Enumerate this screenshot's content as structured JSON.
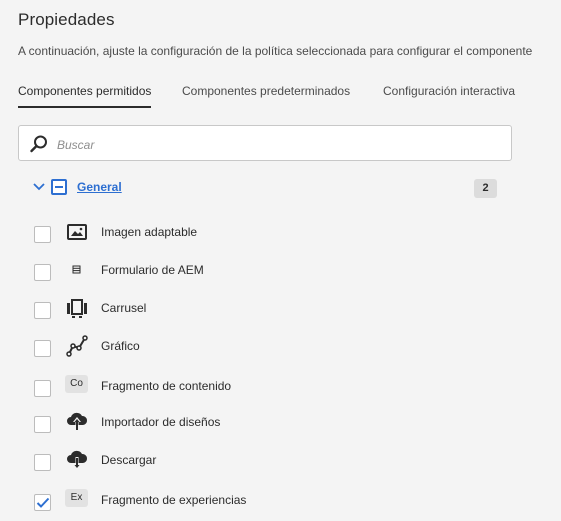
{
  "header": {
    "title": "Propiedades",
    "description": "A continuación, ajuste la configuración de la política seleccionada para configurar el  componente"
  },
  "tabs": [
    {
      "label": "Componentes permitidos",
      "active": true
    },
    {
      "label": "Componentes predeterminados",
      "active": false
    },
    {
      "label": "Configuración interactiva",
      "active": false
    }
  ],
  "search": {
    "placeholder": "Buscar",
    "value": ""
  },
  "group": {
    "label": "General",
    "count": "2",
    "expanded": true,
    "state": "indeterminate"
  },
  "items": [
    {
      "label": "Imagen adaptable",
      "icon": "image-icon",
      "checked": false
    },
    {
      "label": "Formulario de AEM",
      "icon": "form-icon",
      "checked": false
    },
    {
      "label": "Carrusel",
      "icon": "carousel-icon",
      "checked": false
    },
    {
      "label": "Gráfico",
      "icon": "chart-icon",
      "checked": false
    },
    {
      "label": "Fragmento de contenido",
      "icon": "content-fragment-icon",
      "badge": "Co",
      "checked": false
    },
    {
      "label": "Importador de diseños",
      "icon": "cloud-upload-icon",
      "checked": false
    },
    {
      "label": "Descargar",
      "icon": "cloud-download-icon",
      "checked": false
    },
    {
      "label": "Fragmento de experiencias",
      "icon": "experience-fragment-icon",
      "badge": "Ex",
      "checked": true
    }
  ],
  "colors": {
    "accent": "#2d6fd1",
    "background": "#f4f4f4",
    "text": "#2c2c2c"
  }
}
